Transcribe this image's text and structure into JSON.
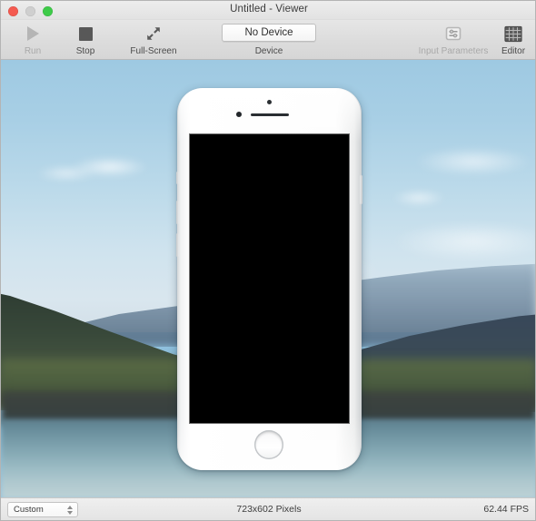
{
  "window": {
    "title": "Untitled - Viewer",
    "traffic_lights": [
      {
        "name": "close",
        "color": "#f45a50"
      },
      {
        "name": "minimize",
        "color": "#cfcfcf"
      },
      {
        "name": "zoom",
        "color": "#3ecb49"
      }
    ]
  },
  "toolbar": {
    "left_items": [
      {
        "label": "Run",
        "icon": "play-triangle-icon",
        "enabled": false
      },
      {
        "label": "Stop",
        "icon": "stop-square-icon",
        "enabled": true
      },
      {
        "label": "Full-Screen",
        "icon": "expand-arrows-icon",
        "enabled": true
      }
    ],
    "device": {
      "button_label": "No Device",
      "caption": "Device"
    },
    "right_items": [
      {
        "label": "Input Parameters",
        "icon": "sliders-panel-icon",
        "enabled": false
      },
      {
        "label": "Editor",
        "icon": "grid-icon",
        "enabled": true
      }
    ]
  },
  "viewer": {
    "background_description": "blurred lake and mountains landscape photo",
    "device_preview": {
      "model": "iphone-white-mockup",
      "screen_state": "black"
    }
  },
  "statusbar": {
    "preset": {
      "value": "Custom"
    },
    "resolution": "723x602 Pixels",
    "framerate": "62.44 FPS"
  }
}
